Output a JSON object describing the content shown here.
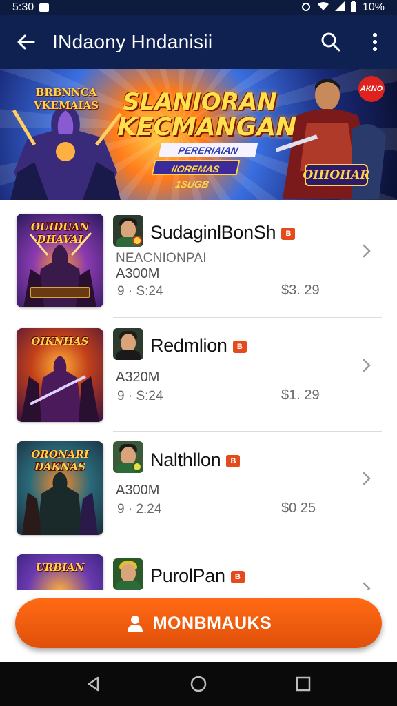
{
  "status_bar": {
    "time": "5:30",
    "battery": "10%"
  },
  "app_bar": {
    "title": "INdaony Hndanisii"
  },
  "banner": {
    "logo_left_line1": "BRBNNCA",
    "logo_left_line2": "VKEMAIAS",
    "headline_line1": "SLANIORAN",
    "headline_line2": "KECMANGAN",
    "ribbon1": "PERERIAIAN",
    "ribbon2": "IIOREMAS 1SUGB",
    "tag_right": "OIHOHAR",
    "badge": "AKNO"
  },
  "apps": [
    {
      "thumb_title": "OUIDUAN DHAVAI",
      "name": "SudaginlBonSh",
      "tag": "B",
      "subtitle": "NEACNIONPAI",
      "size": "A300M",
      "rating": "9 · S:24",
      "price": "$3. 29",
      "thumb_colors": [
        "#2a1a5a",
        "#8a3ab0",
        "#ff9a2a"
      ]
    },
    {
      "thumb_title": "OIKNHAS",
      "name": "Redmlion",
      "tag": "B",
      "subtitle": "",
      "size": "A320M",
      "rating": "9 · S:24",
      "price": "$1. 29",
      "thumb_colors": [
        "#3a1040",
        "#c2401a",
        "#ffb03a"
      ]
    },
    {
      "thumb_title": "ORONARI DAKNAS",
      "name": "Nalthllon",
      "tag": "B",
      "subtitle": "",
      "size": "A300M",
      "rating": "9 · 2.24",
      "price": "$0 25",
      "thumb_colors": [
        "#1a2a3a",
        "#2a6a7a",
        "#ff8a2a"
      ]
    },
    {
      "thumb_title": "URBIAN",
      "name": "PurolPan",
      "tag": "B",
      "subtitle": "",
      "size": "",
      "rating": "",
      "price": "",
      "thumb_colors": [
        "#2a1a6a",
        "#6a3ab0",
        "#ffb03a"
      ]
    }
  ],
  "cta": {
    "label": "MONBMAUKS"
  },
  "colors": {
    "app_bar": "#0f2150",
    "accent": "#f2560e"
  }
}
